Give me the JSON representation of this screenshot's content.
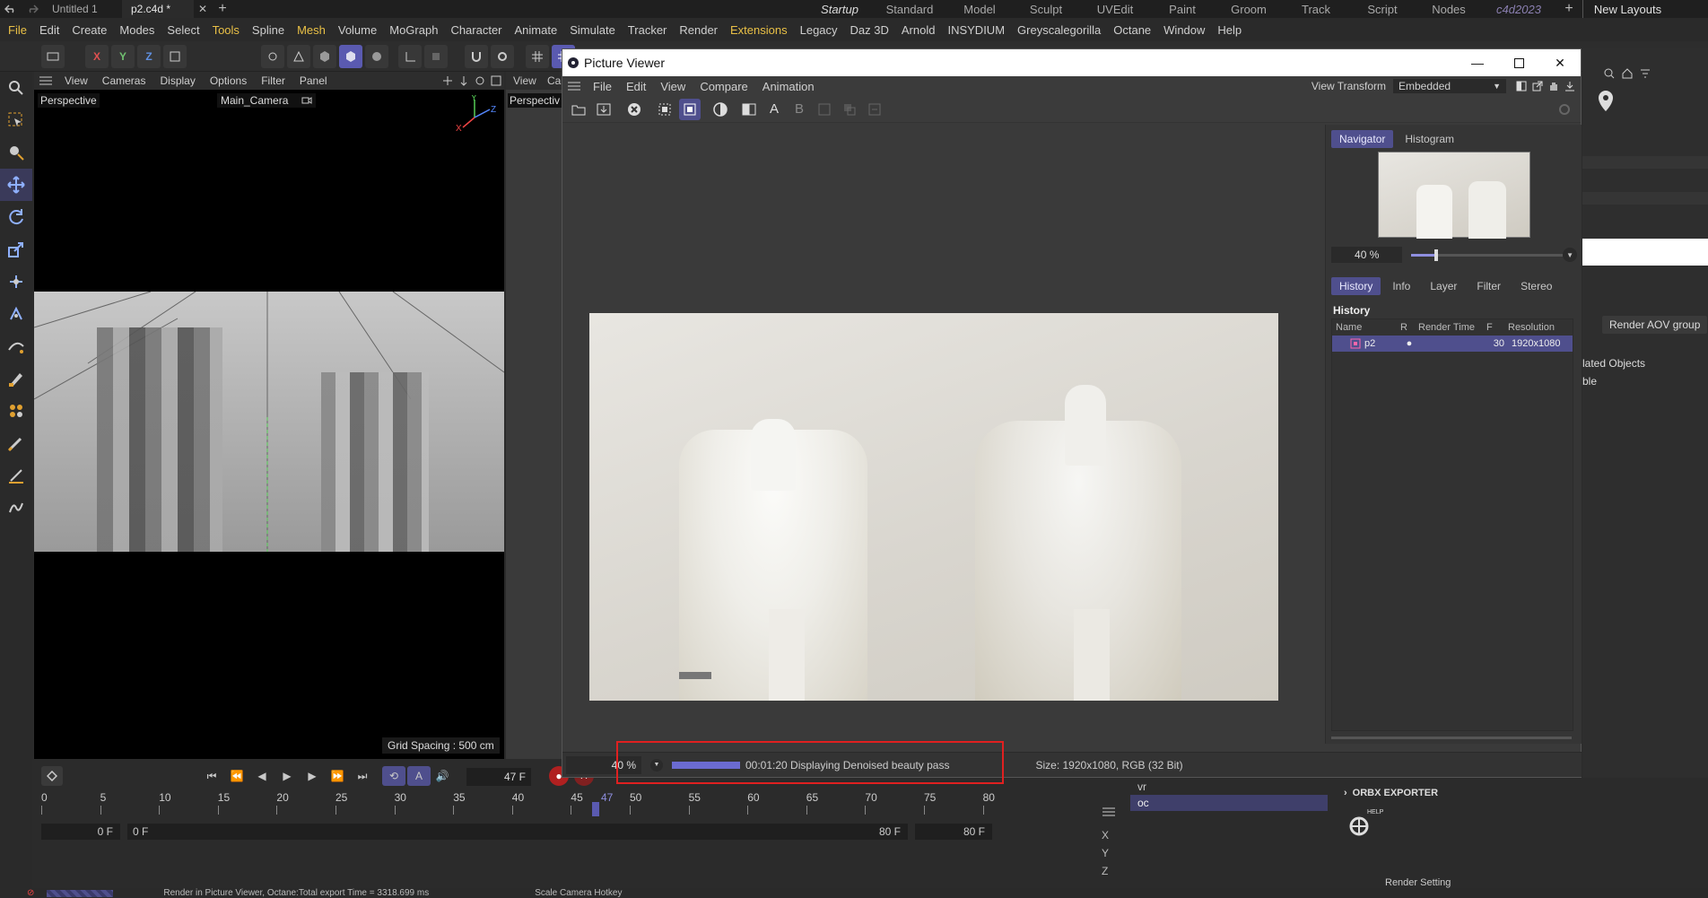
{
  "tabs": {
    "documents": [
      "Untitled 1",
      "p2.c4d *"
    ],
    "layouts": [
      "Startup",
      "Standard",
      "Model",
      "Sculpt",
      "UVEdit",
      "Paint",
      "Groom",
      "Track",
      "Script",
      "Nodes",
      "c4d2023"
    ],
    "active_layout": "Startup",
    "new_layouts_label": "New Layouts"
  },
  "menubar": [
    "File",
    "Edit",
    "Create",
    "Modes",
    "Select",
    "Tools",
    "Spline",
    "Mesh",
    "Volume",
    "MoGraph",
    "Character",
    "Animate",
    "Simulate",
    "Tracker",
    "Render",
    "Extensions",
    "Legacy",
    "Daz 3D",
    "Arnold",
    "INSYDIUM",
    "Greyscalegorilla",
    "Octane",
    "Window",
    "Help"
  ],
  "highlighted_menus": [
    "Tools",
    "Mesh",
    "Extensions"
  ],
  "viewport": {
    "menu": [
      "View",
      "Cameras",
      "Display",
      "Options",
      "Filter",
      "Panel"
    ],
    "label": "Perspective",
    "camera": "Main_Camera",
    "grid_spacing": "Grid Spacing : 500 cm",
    "second_menu": [
      "View",
      "Ca"
    ],
    "second_label": "Perspectiv"
  },
  "picture_viewer": {
    "title": "Picture Viewer",
    "menu": [
      "File",
      "Edit",
      "View",
      "Compare",
      "Animation"
    ],
    "view_transform_label": "View Transform",
    "view_transform_value": "Embedded",
    "tool_letters": [
      "A",
      "B"
    ],
    "nav_tabs": [
      "Navigator",
      "Histogram"
    ],
    "nav_zoom": "40 %",
    "nav_zoom_fraction": 0.15,
    "info_tabs": [
      "History",
      "Info",
      "Layer",
      "Filter",
      "Stereo"
    ],
    "history_title": "History",
    "history_columns": [
      "Name",
      "R",
      "Render Time",
      "F",
      "Resolution"
    ],
    "history_rows": [
      {
        "name": "p2",
        "render_time": "",
        "frames": "30",
        "resolution": "1920x1080"
      }
    ],
    "zoom": "40 %",
    "progress_fraction": 1,
    "status_text": "00:01:20 Displaying Denoised beauty pass",
    "size_text": "Size: 1920x1080, RGB (32 Bit)"
  },
  "timeline": {
    "current_frame": "47 F",
    "ticks": [
      "0",
      "5",
      "10",
      "15",
      "20",
      "25",
      "30",
      "35",
      "40",
      "45",
      "50",
      "55",
      "60",
      "65",
      "70",
      "75",
      "80"
    ],
    "start_field": "0 F",
    "range_start": "0 F",
    "range_end": "80 F",
    "end_field": "80 F",
    "playhead": "47"
  },
  "right_panel": {
    "render_aov_group": "Render AOV group",
    "items": [
      "lated Objects",
      "ble"
    ],
    "objects": [
      "vr",
      "oc"
    ],
    "axes": [
      "X",
      "Y",
      "Z"
    ],
    "orbx_exporter": "ORBX EXPORTER",
    "help_label": "HELP",
    "render_setting": "Render Setting"
  },
  "statusbar": {
    "message": "Render in Picture Viewer, Octane:Total export Time = 3318.699 ms",
    "hint": "Scale Camera Hotkey"
  },
  "colors": {
    "accent": "#4f4f8d",
    "highlight_menu": "#e9c046",
    "annotation_red": "#e02020",
    "progress": "#6b6bd0"
  }
}
